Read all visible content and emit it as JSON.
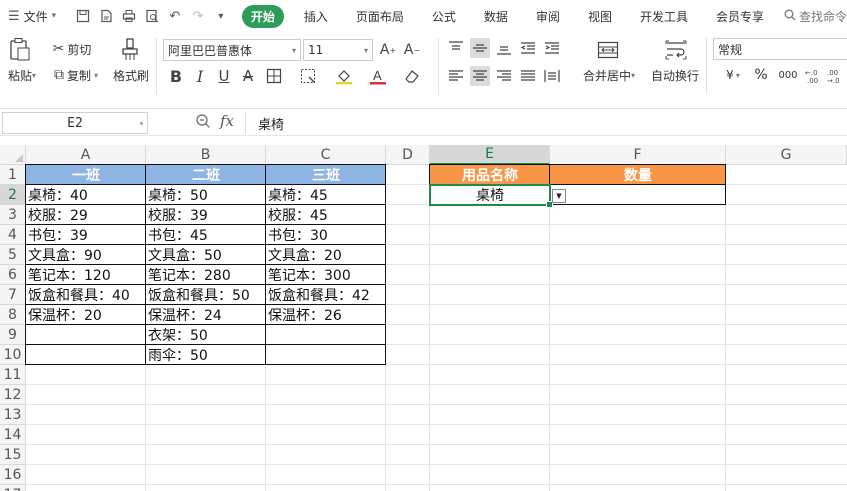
{
  "menubar": {
    "file_label": "文件",
    "tabs": [
      "开始",
      "插入",
      "页面布局",
      "公式",
      "数据",
      "审阅",
      "视图",
      "开发工具",
      "会员专享"
    ],
    "search_label": "查找命令"
  },
  "ribbon": {
    "paste_label": "粘贴",
    "cut_label": "剪切",
    "copy_label": "复制",
    "format_painter_label": "格式刷",
    "font_name": "阿里巴巴普惠体",
    "font_size": "11",
    "merge_center_label": "合并居中",
    "wrap_text_label": "自动换行",
    "number_format": "常规",
    "currency_symbol": "¥",
    "percent_symbol": "%",
    "thousands_symbol": "000",
    "inc_decimal": "+.0\n.00",
    "dec_decimal": ".00\n→.0"
  },
  "formula_bar": {
    "cell_ref": "E2",
    "fx": "fx",
    "value": "桌椅"
  },
  "columns": [
    "A",
    "B",
    "C",
    "D",
    "E",
    "F",
    "G"
  ],
  "rows": [
    "1",
    "2",
    "3",
    "4",
    "5",
    "6",
    "7",
    "8",
    "9",
    "10",
    "11",
    "12",
    "13",
    "14",
    "15",
    "16",
    "17"
  ],
  "sheet": {
    "headers": [
      "一班",
      "二班",
      "三班"
    ],
    "col_a": [
      "桌椅：40",
      "校服：29",
      "书包：39",
      "文具盒：90",
      "笔记本：120",
      "饭盒和餐具：40",
      "保温杯：20",
      ""
    ],
    "col_b": [
      "桌椅：50",
      "校服：39",
      "书包：45",
      "文具盒：50",
      "笔记本：280",
      "饭盒和餐具：50",
      "保温杯：24",
      "衣架：50",
      "雨伞：50"
    ],
    "col_c": [
      "桌椅：45",
      "校服：45",
      "书包：30",
      "文具盒：20",
      "笔记本：300",
      "饭盒和餐具：42",
      "保温杯：26",
      "",
      ""
    ],
    "lookup_header_name": "用品名称",
    "lookup_header_qty": "数量",
    "lookup_value": "桌椅",
    "lookup_qty": ""
  },
  "colors": {
    "accent_green": "#2e9d5b",
    "header_blue": "#8eb4e3",
    "header_orange": "#f79646"
  }
}
